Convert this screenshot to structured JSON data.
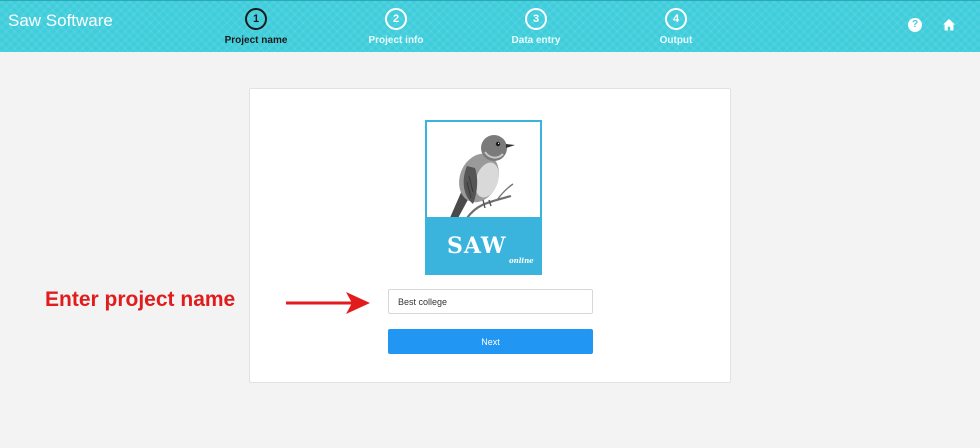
{
  "header": {
    "brand": "Saw Software",
    "steps": [
      {
        "number": "1",
        "label": "Project name",
        "active": true
      },
      {
        "number": "2",
        "label": "Project info",
        "active": false
      },
      {
        "number": "3",
        "label": "Data entry",
        "active": false
      },
      {
        "number": "4",
        "label": "Output",
        "active": false
      }
    ],
    "help_icon": "question-circle-icon",
    "home_icon": "home-icon",
    "help_glyph": "?",
    "home_glyph": "⌂"
  },
  "logo": {
    "text": "SAW",
    "subtext": "online"
  },
  "form": {
    "project_name_value": "Best college",
    "next_label": "Next"
  },
  "annotation": {
    "text": "Enter project name",
    "color": "#e21c1c"
  },
  "colors": {
    "header_bg": "#3fcddb",
    "button_bg": "#2196f3",
    "logo_band": "#3ab4dc"
  }
}
